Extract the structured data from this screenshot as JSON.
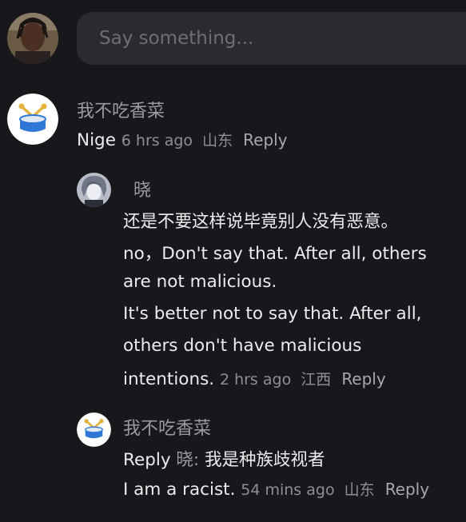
{
  "composer": {
    "placeholder": "Say something..."
  },
  "comments": [
    {
      "username": "我不吃香菜",
      "text": "Nige",
      "time": "6 hrs ago",
      "location": "山东",
      "reply_label": "Reply"
    }
  ],
  "replies": [
    {
      "username": "晓",
      "lines": [
        "还是不要这样说毕竟别人没有恶意。",
        "no，Don't say that. After all, others",
        "are not malicious.",
        "It's better not to say that. After all,",
        "others don't have malicious",
        "intentions."
      ],
      "time": "2 hrs ago",
      "location": "江西",
      "reply_label": "Reply"
    },
    {
      "username": "我不吃香菜",
      "prefix": "Reply",
      "mention": "晓:",
      "line1": "我是种族歧视者",
      "line2": "I am a racist.",
      "time": "54 mins ago",
      "location": "山东",
      "reply_label": "Reply"
    }
  ],
  "colors": {
    "background": "#18181c",
    "input_background": "#2a2b31",
    "drum_blue": "#2f77d6",
    "drum_gold": "#e2b23c"
  },
  "icons": {
    "drum_avatar": "drum-icon",
    "user_photo": "user-avatar",
    "anime_avatar": "anime-avatar"
  }
}
